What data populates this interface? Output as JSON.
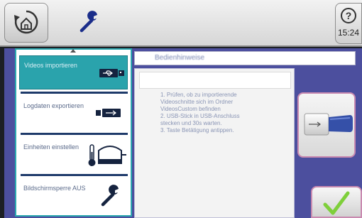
{
  "header": {
    "home_icon": "home-back-icon",
    "tool_icon": "wrench-icon",
    "help_glyph": "?",
    "time": "15:24"
  },
  "menu": {
    "items": [
      {
        "label": "Videos importieren",
        "icon": "usb-icon",
        "active": true
      },
      {
        "label": "Logdaten exportieren",
        "icon": "usb-export-icon",
        "active": false
      },
      {
        "label": "Einheiten einstellen",
        "icon": "thermometer-pan-icon",
        "active": false
      },
      {
        "label": "Bildschirmsperre AUS",
        "icon": "wrench-icon",
        "active": false
      }
    ]
  },
  "content": {
    "title": "Bedienhinweise",
    "instructions": [
      "1. Prüfen, ob zu importierende",
      "Videoschnitte sich im Ordner",
      "VideosCustom befinden",
      "2. USB-Stick in USB-Anschluss",
      "stecken und 30s warten.",
      "3. Taste Betätigung antippen."
    ]
  },
  "preview": {
    "icon": "usb-stick-icon"
  },
  "ok_button": {
    "icon": "checkmark-icon"
  },
  "colors": {
    "accent": "#2aa3ac",
    "background": "#4c4f9e",
    "ok_check": "#7ecf3a",
    "button_border": "#c98ab0"
  }
}
